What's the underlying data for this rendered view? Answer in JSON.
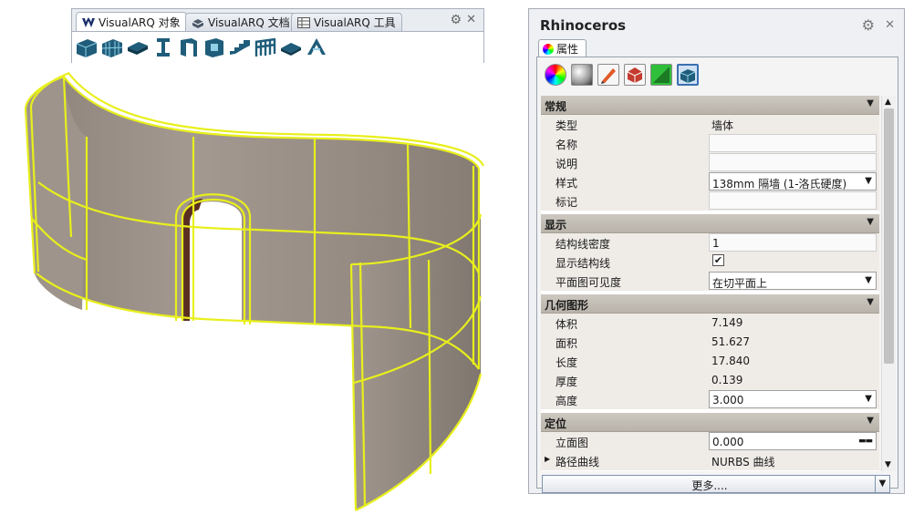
{
  "toolbar": {
    "tabs": [
      {
        "label": "VisualARQ 对象",
        "icon": "visualarq-logo-icon"
      },
      {
        "label": "VisualARQ 文档",
        "icon": "document-box-icon"
      },
      {
        "label": "VisualARQ 工具",
        "icon": "tools-table-icon"
      }
    ],
    "active_tab": 0,
    "buttons": [
      "wall-icon",
      "curtain-wall-icon",
      "slab-icon",
      "beam-icon",
      "door-icon",
      "window-icon",
      "stair-icon",
      "railing-icon",
      "roof-icon",
      "column-icon"
    ]
  },
  "panel": {
    "title": "Rhinoceros",
    "tab_label": "属性",
    "icons": [
      "color-wheel-icon",
      "material-sphere-icon",
      "pencil-icon",
      "render-icon",
      "texture-icon",
      "wall-object-icon"
    ],
    "selected_icon": 5,
    "sections": {
      "general": {
        "title": "常规",
        "rows": [
          {
            "name": "类型",
            "value": "墙体"
          },
          {
            "name": "名称",
            "value": ""
          },
          {
            "name": "说明",
            "value": ""
          },
          {
            "name": "样式",
            "value": "138mm 隔墙 (1-洛氏硬度)"
          },
          {
            "name": "标记",
            "value": ""
          }
        ]
      },
      "display": {
        "title": "显示",
        "rows": [
          {
            "name": "结构线密度",
            "value": "1"
          },
          {
            "name": "显示结构线",
            "value": "✔"
          },
          {
            "name": "平面图可见度",
            "value": "在切平面上"
          }
        ]
      },
      "geometry": {
        "title": "几何图形",
        "rows": [
          {
            "name": "体积",
            "value": "7.149"
          },
          {
            "name": "面积",
            "value": "51.627"
          },
          {
            "name": "长度",
            "value": "17.840"
          },
          {
            "name": "厚度",
            "value": "0.139"
          },
          {
            "name": "高度",
            "value": "3.000"
          }
        ]
      },
      "position": {
        "title": "定位",
        "rows": [
          {
            "name": "立面图",
            "value": "0.000"
          },
          {
            "name": "路径曲线",
            "value": "NURBS 曲线"
          }
        ]
      }
    },
    "more_button": "更多...."
  },
  "colors": {
    "wall_fill": "#958b82",
    "wall_highlight": "#e8ef1c",
    "door_color": "#5a2f22"
  }
}
